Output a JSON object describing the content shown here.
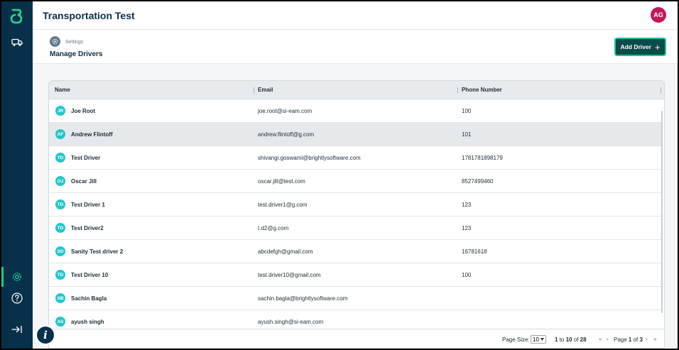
{
  "app": {
    "title": "Transportation Test",
    "user_initials": "AG"
  },
  "breadcrumb": {
    "section": "Settings"
  },
  "page": {
    "title": "Manage Drivers",
    "add_button": "Add Driver",
    "add_icon": "+"
  },
  "grid": {
    "columns": [
      "Name",
      "Email",
      "Phone Number"
    ],
    "rows": [
      {
        "initials": "JR",
        "name": "Joe Root",
        "email": "joe.root@si-eam.com",
        "phone": "100"
      },
      {
        "initials": "AF",
        "name": "Andrew Flintoff",
        "email": "andrew.flintoff@g.com",
        "phone": "101"
      },
      {
        "initials": "TD",
        "name": "Test Driver",
        "email": "shivangi.goswami@brightlysoftware.com",
        "phone": "1781781898179"
      },
      {
        "initials": "OJ",
        "name": "Oscar Jill",
        "email": "oscar.jill@test.com",
        "phone": "8527499460"
      },
      {
        "initials": "TD",
        "name": "Test Driver 1",
        "email": "test.driver1@g.com",
        "phone": "123"
      },
      {
        "initials": "TD",
        "name": "Test Driver2",
        "email": "t.d2@g.com",
        "phone": "123"
      },
      {
        "initials": "SD",
        "name": "Sanity Test driver 2",
        "email": "abcdefgh@gmail.com",
        "phone": "16781618"
      },
      {
        "initials": "TD",
        "name": "Test Driver 10",
        "email": "test.driver10@gmail.com",
        "phone": "100"
      },
      {
        "initials": "SB",
        "name": "Sachin Bagla",
        "email": "sachin.bagla@brightlysoftware.com",
        "phone": ""
      },
      {
        "initials": "AS",
        "name": "ayush singh",
        "email": "ayush.singh@si-eam.com",
        "phone": ""
      }
    ],
    "selected_row": 1
  },
  "pagination": {
    "page_size_label": "Page Size:",
    "page_size": "10",
    "range_from": "1",
    "range_to_word": "to",
    "range_to": "10",
    "range_of_word": "of",
    "total": "28",
    "page_word": "Page",
    "page_current": "1",
    "page_of_word": "of",
    "page_total": "3"
  },
  "icons": {
    "logo": "brand-logo-icon",
    "truck": "truck-icon",
    "settings": "gear-icon",
    "help": "help-icon",
    "collapse": "expand-sidebar-icon",
    "info": "info-icon"
  },
  "colors": {
    "sidebar": "#07304a",
    "accent": "#1fc28e",
    "button": "#0b4b4a",
    "avatar_initials": "#22c5c9",
    "user_avatar": "#c2185b"
  }
}
